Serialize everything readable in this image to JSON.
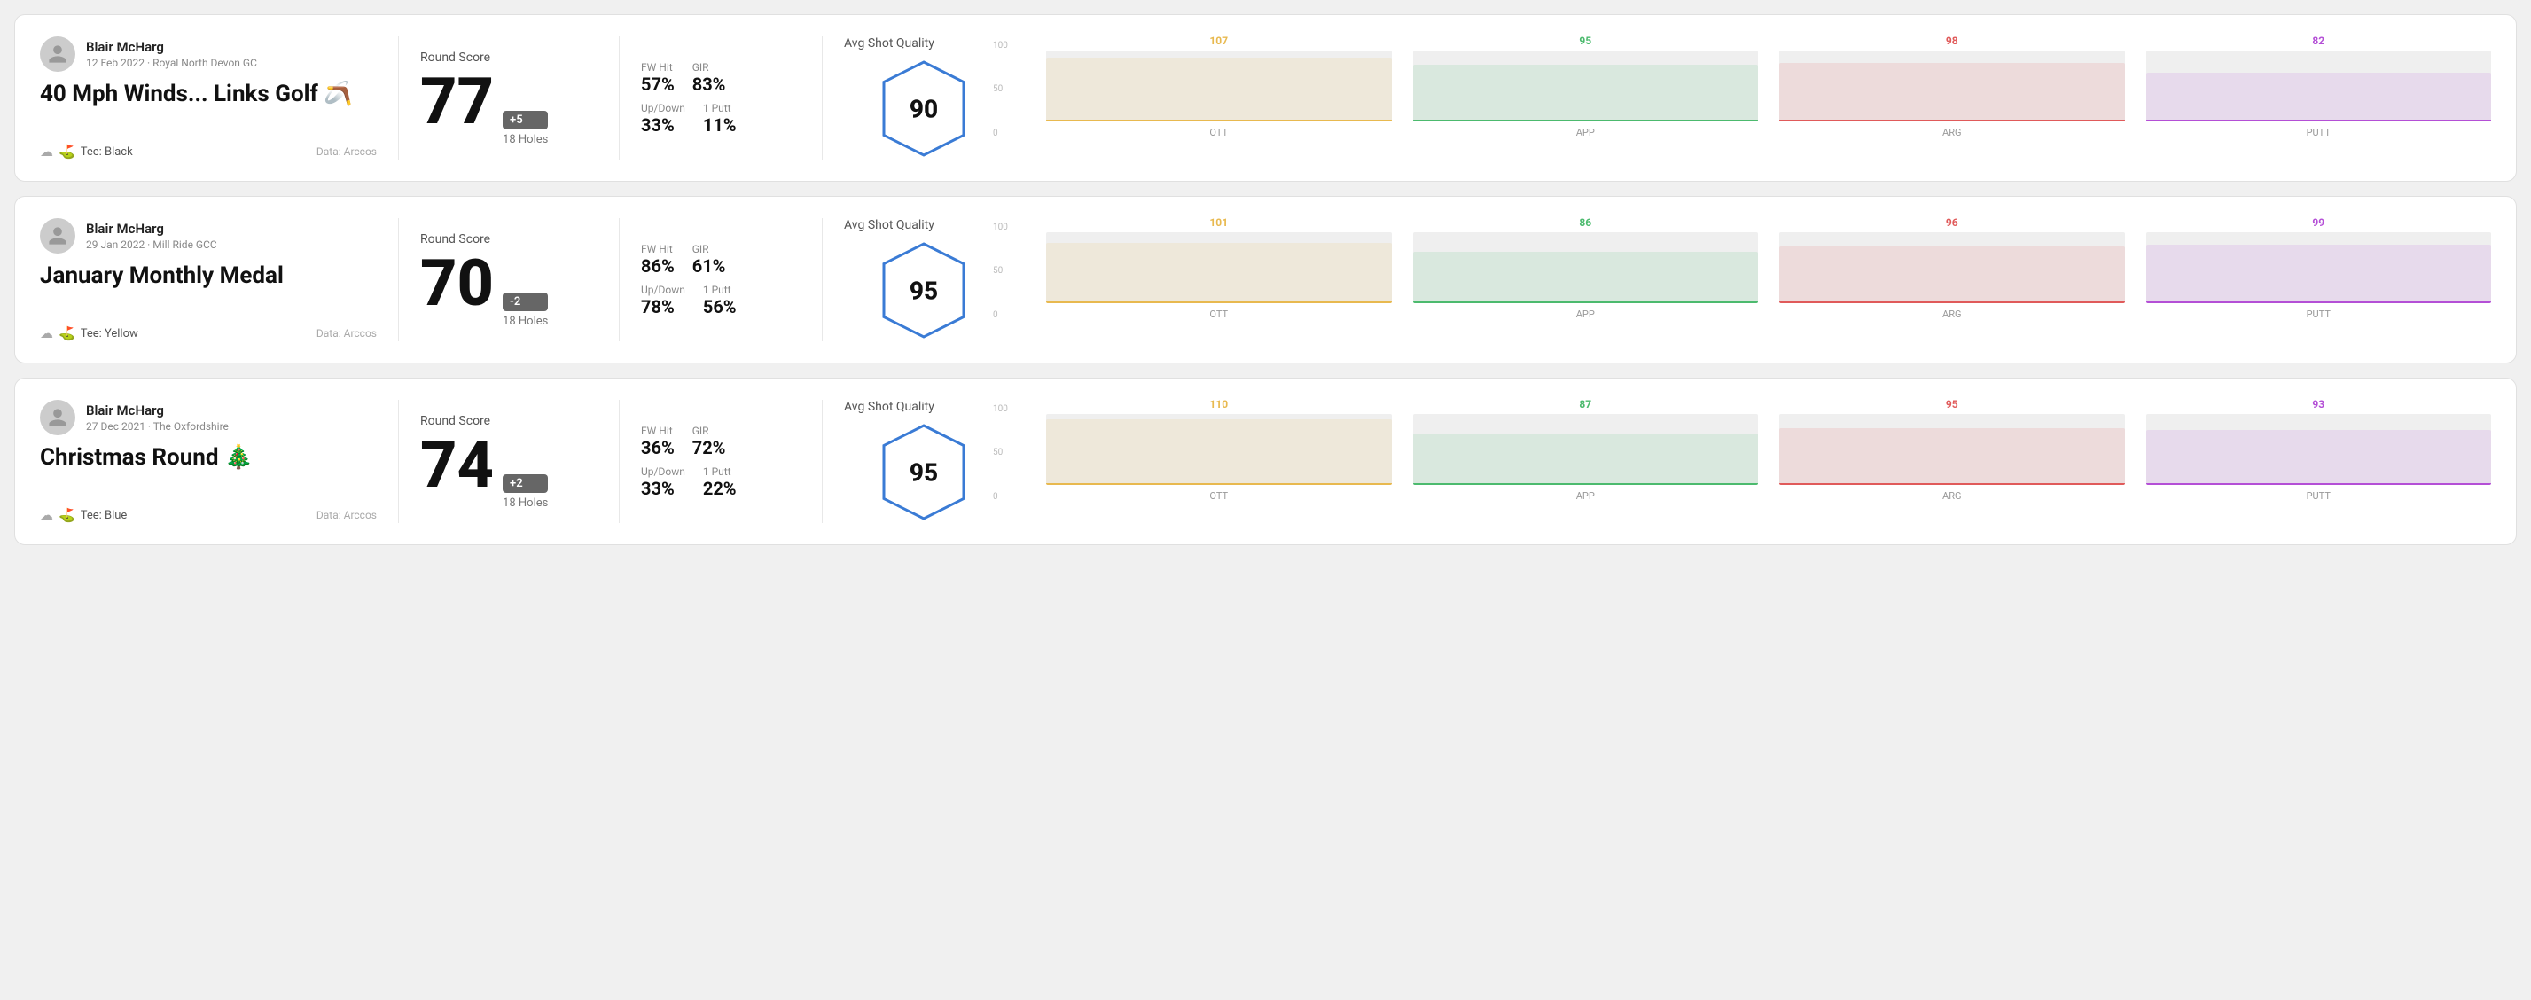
{
  "rounds": [
    {
      "id": "round1",
      "user": {
        "name": "Blair McHarg",
        "date_course": "12 Feb 2022 · Royal North Devon GC"
      },
      "title": "40 Mph Winds... Links Golf 🪃",
      "tee": "Black",
      "data_source": "Data: Arccos",
      "score": {
        "label": "Round Score",
        "number": "77",
        "badge": "+5",
        "badge_type": "over",
        "holes": "18 Holes"
      },
      "stats": {
        "fw_hit_label": "FW Hit",
        "fw_hit_value": "57%",
        "gir_label": "GIR",
        "gir_value": "83%",
        "updown_label": "Up/Down",
        "updown_value": "33%",
        "oneputt_label": "1 Putt",
        "oneputt_value": "11%"
      },
      "quality": {
        "label": "Avg Shot Quality",
        "score": "90"
      },
      "chart": {
        "bars": [
          {
            "label": "OTT",
            "value": 107,
            "color": "#e8b94f",
            "max": 120
          },
          {
            "label": "APP",
            "value": 95,
            "color": "#4cba6e",
            "max": 120
          },
          {
            "label": "ARG",
            "value": 98,
            "color": "#e05a5a",
            "max": 120
          },
          {
            "label": "PUTT",
            "value": 82,
            "color": "#b44fd6",
            "max": 120
          }
        ]
      }
    },
    {
      "id": "round2",
      "user": {
        "name": "Blair McHarg",
        "date_course": "29 Jan 2022 · Mill Ride GCC"
      },
      "title": "January Monthly Medal",
      "tee": "Yellow",
      "data_source": "Data: Arccos",
      "score": {
        "label": "Round Score",
        "number": "70",
        "badge": "-2",
        "badge_type": "under",
        "holes": "18 Holes"
      },
      "stats": {
        "fw_hit_label": "FW Hit",
        "fw_hit_value": "86%",
        "gir_label": "GIR",
        "gir_value": "61%",
        "updown_label": "Up/Down",
        "updown_value": "78%",
        "oneputt_label": "1 Putt",
        "oneputt_value": "56%"
      },
      "quality": {
        "label": "Avg Shot Quality",
        "score": "95"
      },
      "chart": {
        "bars": [
          {
            "label": "OTT",
            "value": 101,
            "color": "#e8b94f",
            "max": 120
          },
          {
            "label": "APP",
            "value": 86,
            "color": "#4cba6e",
            "max": 120
          },
          {
            "label": "ARG",
            "value": 96,
            "color": "#e05a5a",
            "max": 120
          },
          {
            "label": "PUTT",
            "value": 99,
            "color": "#b44fd6",
            "max": 120
          }
        ]
      }
    },
    {
      "id": "round3",
      "user": {
        "name": "Blair McHarg",
        "date_course": "27 Dec 2021 · The Oxfordshire"
      },
      "title": "Christmas Round 🎄",
      "tee": "Blue",
      "data_source": "Data: Arccos",
      "score": {
        "label": "Round Score",
        "number": "74",
        "badge": "+2",
        "badge_type": "over",
        "holes": "18 Holes"
      },
      "stats": {
        "fw_hit_label": "FW Hit",
        "fw_hit_value": "36%",
        "gir_label": "GIR",
        "gir_value": "72%",
        "updown_label": "Up/Down",
        "updown_value": "33%",
        "oneputt_label": "1 Putt",
        "oneputt_value": "22%"
      },
      "quality": {
        "label": "Avg Shot Quality",
        "score": "95"
      },
      "chart": {
        "bars": [
          {
            "label": "OTT",
            "value": 110,
            "color": "#e8b94f",
            "max": 120
          },
          {
            "label": "APP",
            "value": 87,
            "color": "#4cba6e",
            "max": 120
          },
          {
            "label": "ARG",
            "value": 95,
            "color": "#e05a5a",
            "max": 120
          },
          {
            "label": "PUTT",
            "value": 93,
            "color": "#b44fd6",
            "max": 120
          }
        ]
      }
    }
  ],
  "y_axis_labels": [
    "100",
    "50",
    "0"
  ]
}
